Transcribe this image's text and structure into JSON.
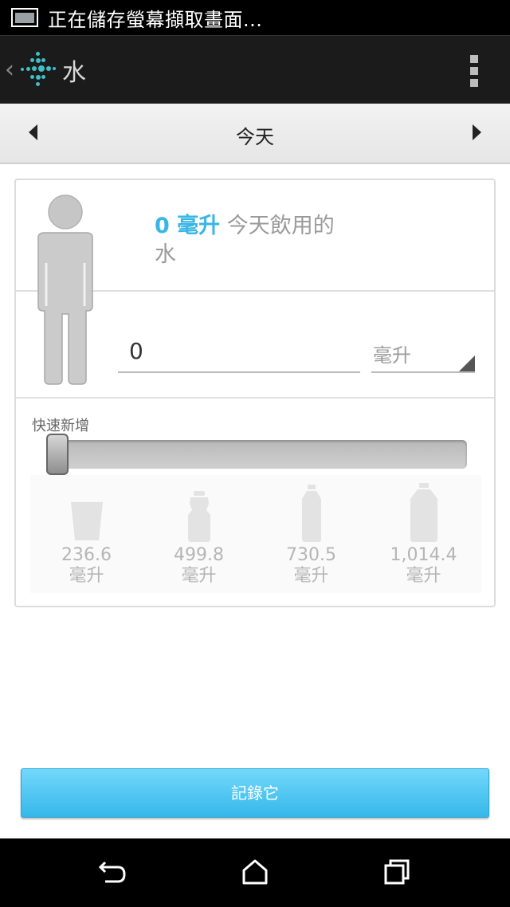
{
  "status_bar": {
    "text": "正在儲存螢幕擷取畫面..."
  },
  "action_bar": {
    "title": "水"
  },
  "date_nav": {
    "label": "今天"
  },
  "summary": {
    "amount": "0 毫升",
    "text": "今天飲用的水"
  },
  "entry": {
    "amount_value": "0",
    "unit": "毫升"
  },
  "quick_add": {
    "label": "快速新增",
    "slider_value": 0,
    "presets": [
      {
        "icon": "glass-icon",
        "value": "236.6",
        "unit": "毫升"
      },
      {
        "icon": "sport-bottle-icon",
        "value": "499.8",
        "unit": "毫升"
      },
      {
        "icon": "bottle-icon",
        "value": "730.5",
        "unit": "毫升"
      },
      {
        "icon": "large-bottle-icon",
        "value": "1,014.4",
        "unit": "毫升"
      }
    ]
  },
  "log_button": {
    "label": "記錄它"
  },
  "colors": {
    "accent": "#38b6e6",
    "button": "#4cc6f3"
  }
}
